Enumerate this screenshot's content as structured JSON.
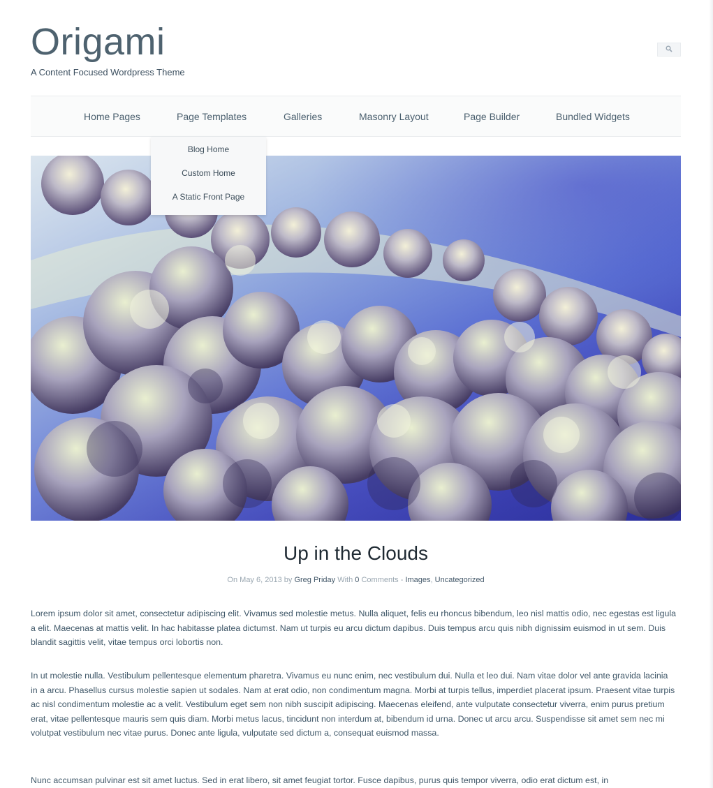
{
  "site": {
    "title": "Origami",
    "tagline": "A Content Focused Wordpress Theme"
  },
  "search": {
    "icon": "search-icon"
  },
  "nav": {
    "items": [
      {
        "label": "Home Pages"
      },
      {
        "label": "Page Templates"
      },
      {
        "label": "Galleries"
      },
      {
        "label": "Masonry Layout"
      },
      {
        "label": "Page Builder"
      },
      {
        "label": "Bundled Widgets"
      }
    ],
    "dropdown": [
      {
        "label": "Blog Home"
      },
      {
        "label": "Custom Home"
      },
      {
        "label": "A Static Front Page"
      }
    ]
  },
  "post": {
    "title": "Up in the Clouds",
    "meta": {
      "on": "On",
      "date": "May 6, 2013",
      "by": "by",
      "author": "Greg Priday",
      "with": "With",
      "comments_count": "0",
      "comments": "Comments",
      "dash": "-",
      "cat1": "Images",
      "comma": ",",
      "cat2": "Uncategorized"
    },
    "paragraphs": [
      "Lorem ipsum dolor sit amet, consectetur adipiscing elit. Vivamus sed molestie metus. Nulla aliquet, felis eu rhoncus bibendum, leo nisl mattis odio, nec egestas est ligula a elit. Maecenas at mattis velit. In hac habitasse platea dictumst. Nam ut turpis eu arcu dictum dapibus. Duis tempus arcu quis nibh dignissim euismod in ut sem. Duis blandit sagittis velit, vitae tempus orci lobortis non.",
      "In ut molestie nulla. Vestibulum pellentesque elementum pharetra. Vivamus eu nunc enim, nec vestibulum dui. Nulla et leo dui. Nam vitae dolor vel ante gravida lacinia in a arcu. Phasellus cursus molestie sapien ut sodales. Nam at erat odio, non condimentum magna. Morbi at turpis tellus, imperdiet placerat ipsum. Praesent vitae turpis ac nisl condimentum molestie ac a velit. Vestibulum eget sem non nibh suscipit adipiscing. Maecenas eleifend, ante vulputate consectetur viverra, enim purus pretium erat, vitae pellentesque mauris sem quis diam. Morbi metus lacus, tincidunt non interdum at, bibendum id urna. Donec ut arcu arcu. Suspendisse sit amet sem nec mi volutpat vestibulum nec vitae purus. Donec ante ligula, vulputate sed dictum a, consequat euismod massa.",
      "Nunc accumsan pulvinar est sit amet luctus. Sed in erat libero, sit amet feugiat tortor. Fusce dapibus, purus quis tempor viverra, odio erat dictum est, in"
    ]
  }
}
